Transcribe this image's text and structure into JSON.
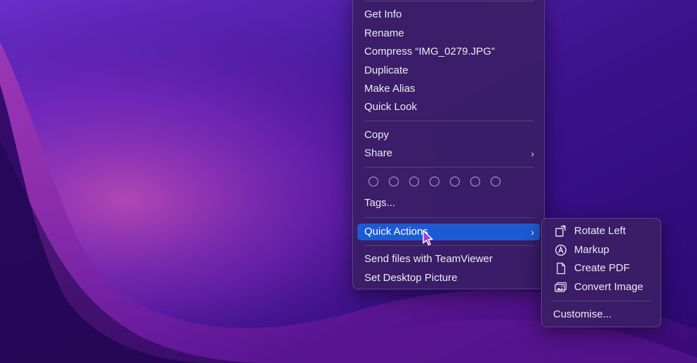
{
  "context_menu": {
    "items": [
      {
        "label": "Get Info"
      },
      {
        "label": "Rename"
      },
      {
        "label": "Compress “IMG_0279.JPG”"
      },
      {
        "label": "Duplicate"
      },
      {
        "label": "Make Alias"
      },
      {
        "label": "Quick Look"
      },
      {
        "label": "Copy"
      },
      {
        "label": "Share"
      },
      {
        "label": "Tags..."
      },
      {
        "label": "Quick Actions"
      },
      {
        "label": "Send files with TeamViewer"
      },
      {
        "label": "Set Desktop Picture"
      }
    ],
    "share_chevron": "›",
    "quick_actions_chevron": "›",
    "highlighted_item": "Quick Actions",
    "highlight_color": "#1c5bd3",
    "tag_colors_count": 7
  },
  "quick_actions_submenu": {
    "items": [
      {
        "label": "Rotate Left",
        "icon": "rotate-left-icon"
      },
      {
        "label": "Markup",
        "icon": "markup-icon"
      },
      {
        "label": "Create PDF",
        "icon": "document-icon"
      },
      {
        "label": "Convert Image",
        "icon": "photos-icon"
      }
    ],
    "customise_label": "Customise..."
  },
  "desktop": {
    "wallpaper": "purple-waves",
    "colors": [
      "#3a0f86",
      "#7d2fd0",
      "#b02fb8",
      "#1a0640"
    ]
  }
}
